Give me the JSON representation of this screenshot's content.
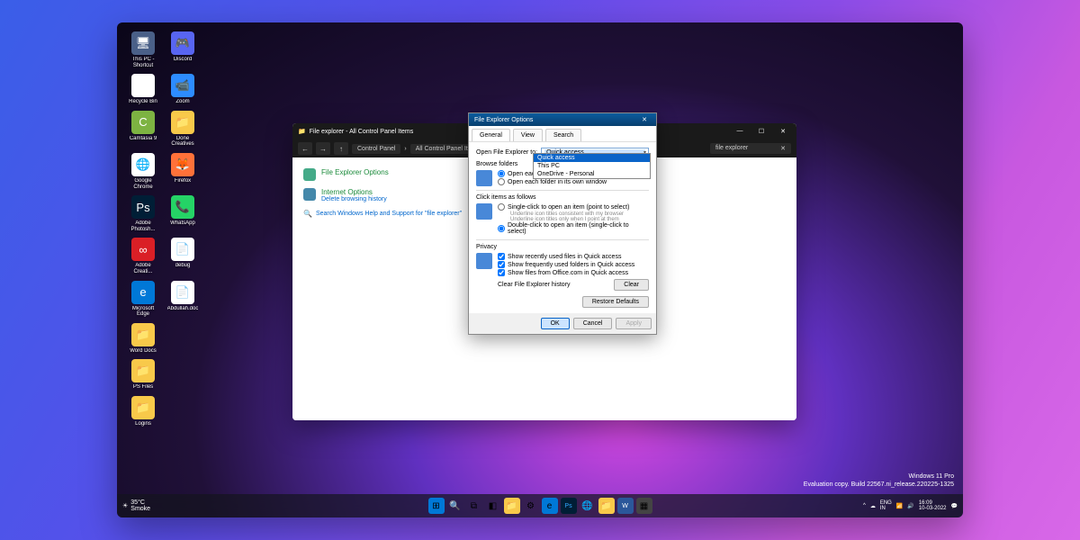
{
  "desktop_icons": [
    [
      {
        "label": "This PC - Shortcut",
        "bg": "#4a6088",
        "glyph": "🖥"
      },
      {
        "label": "Discord",
        "bg": "#5865F2",
        "glyph": "🎮"
      }
    ],
    [
      {
        "label": "Recycle Bin",
        "bg": "#fff",
        "glyph": "🗑"
      },
      {
        "label": "Zoom",
        "bg": "#2D8CFF",
        "glyph": "📹"
      }
    ],
    [
      {
        "label": "Camtasia 9",
        "bg": "#7db342",
        "glyph": "C"
      },
      {
        "label": "Done Creatives",
        "bg": "#f8c94a",
        "glyph": "📁"
      }
    ],
    [
      {
        "label": "Google Chrome",
        "bg": "#fff",
        "glyph": "🌐"
      },
      {
        "label": "Firefox",
        "bg": "#ff7139",
        "glyph": "🦊"
      }
    ],
    [
      {
        "label": "Adobe Photosh...",
        "bg": "#001e36",
        "glyph": "Ps"
      },
      {
        "label": "WhatsApp",
        "bg": "#25D366",
        "glyph": "📞"
      }
    ],
    [
      {
        "label": "Adobe Creati...",
        "bg": "#da1f26",
        "glyph": "∞"
      },
      {
        "label": "debug",
        "bg": "#fff",
        "glyph": "📄"
      }
    ],
    [
      {
        "label": "Microsoft Edge",
        "bg": "#0078D7",
        "glyph": "e"
      },
      {
        "label": "Abdullah.doc",
        "bg": "#fff",
        "glyph": "📄"
      }
    ],
    [
      {
        "label": "Word Docs",
        "bg": "#f8c94a",
        "glyph": "📁"
      }
    ],
    [
      {
        "label": "PS Files",
        "bg": "#f8c94a",
        "glyph": "📁"
      }
    ],
    [
      {
        "label": "Logins",
        "bg": "#f8c94a",
        "glyph": "📁"
      }
    ]
  ],
  "watermark": {
    "line1": "Windows 11 Pro",
    "line2": "Evaluation copy. Build 22567.ni_release.220225-1325"
  },
  "taskbar": {
    "weather_temp": "35°C",
    "weather_cond": "Smoke",
    "lang": "ENG",
    "region": "IN",
    "time": "16:09",
    "date": "10-03-2022"
  },
  "cp": {
    "title": "File explorer - All Control Panel Items",
    "breadcrumb": [
      "Control Panel",
      "All Control Panel Items"
    ],
    "search_hint": "file explorer",
    "items": [
      {
        "title": "File Explorer Options",
        "sub": ""
      },
      {
        "title": "Internet Options",
        "sub": "Delete browsing history"
      }
    ],
    "help": "Search Windows Help and Support for \"file explorer\""
  },
  "dlg": {
    "title": "File Explorer Options",
    "tabs": [
      "General",
      "View",
      "Search"
    ],
    "open_label": "Open File Explorer to:",
    "open_value": "Quick access",
    "dropdown_opts": [
      "Quick access",
      "This PC",
      "OneDrive - Personal"
    ],
    "browse_label": "Browse folders",
    "browse_opts": [
      "Open each folder in the same window",
      "Open each folder in its own window"
    ],
    "browse_sel": 0,
    "click_label": "Click items as follows",
    "click_opts": [
      "Single-click to open an item (point to select)",
      "Double-click to open an item (single-click to select)"
    ],
    "click_sub": [
      "Underline icon titles consistent with my browser",
      "Underline icon titles only when I point at them"
    ],
    "click_sel": 1,
    "privacy_label": "Privacy",
    "privacy_opts": [
      "Show recently used files in Quick access",
      "Show frequently used folders in Quick access",
      "Show files from Office.com in Quick access"
    ],
    "clear_label": "Clear File Explorer history",
    "clear_btn": "Clear",
    "restore_btn": "Restore Defaults",
    "ok": "OK",
    "cancel": "Cancel",
    "apply": "Apply"
  }
}
